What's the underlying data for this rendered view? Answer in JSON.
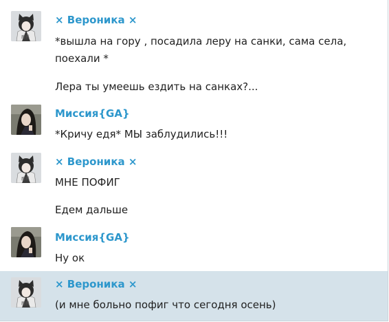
{
  "messages": [
    {
      "author": "× Вероника ×",
      "avatar": "cat-girl-avatar",
      "lines": [
        "*вышла на гору , посадила леру на санки, сама села,",
        "поехали *"
      ],
      "extra": "Лера ты умеешь ездить на санках?..."
    },
    {
      "author": "Миссия{GA}",
      "avatar": "girl-photo-avatar",
      "lines": [
        "*Кричу едя* МЫ заблудились!!!"
      ]
    },
    {
      "author": "× Вероника ×",
      "avatar": "cat-girl-avatar",
      "lines": [
        "МНЕ ПОФИГ"
      ],
      "extra": "Едем дальше"
    },
    {
      "author": "Миссия{GA}",
      "avatar": "girl-photo-avatar",
      "lines": [
        "Ну ок"
      ]
    },
    {
      "author": "× Вероника ×",
      "avatar": "cat-girl-avatar",
      "lines": [
        "(и мне больно пофиг что сегодня осень)"
      ],
      "highlighted": true
    }
  ],
  "colors": {
    "author": "#2d97cc",
    "text": "#1f1f1f",
    "highlight_bg": "#d5e2ea",
    "background": "#ffffff"
  }
}
